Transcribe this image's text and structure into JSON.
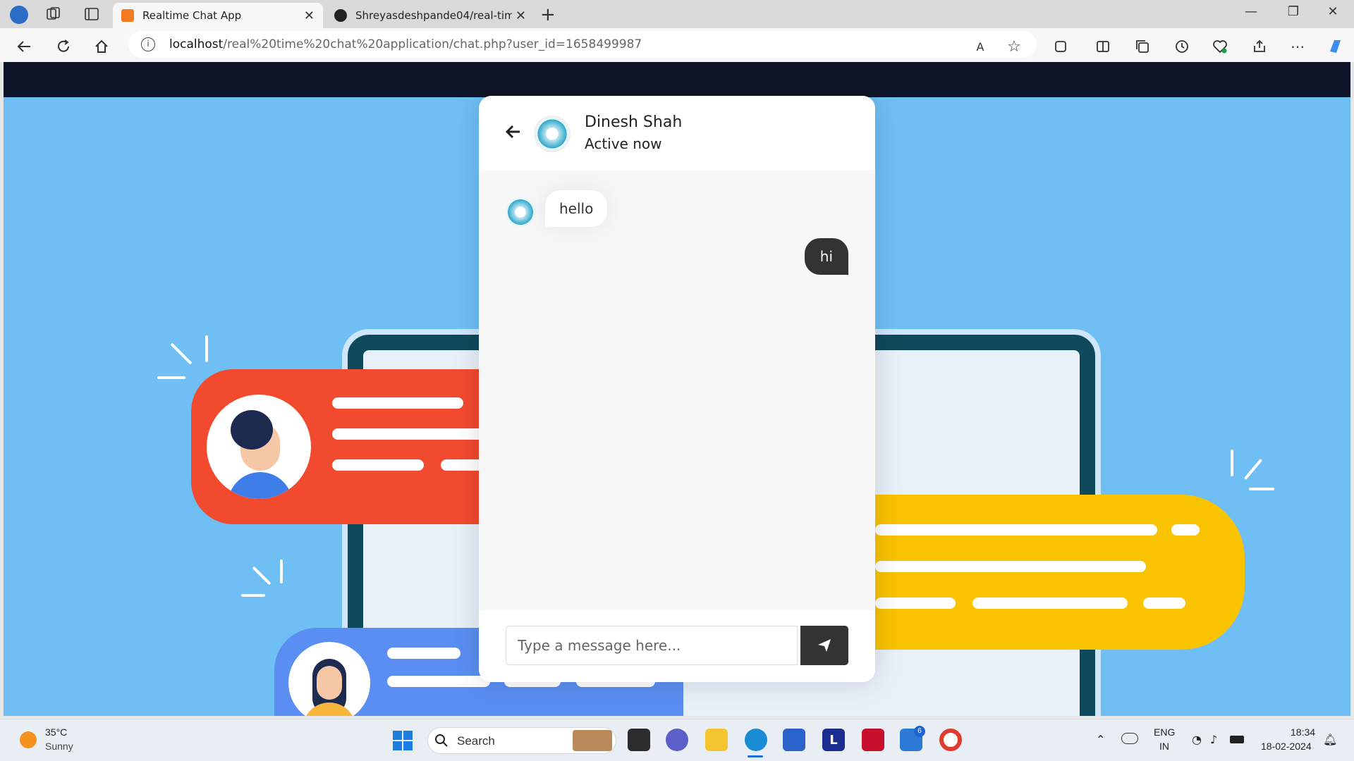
{
  "browser": {
    "tabs": [
      {
        "title": "Realtime Chat App",
        "active": true
      },
      {
        "title": "Shreyasdeshpande04/real-time-c",
        "active": false
      }
    ],
    "url_host": "localhost",
    "url_path": "/real%20time%20chat%20application/chat.php?user_id=1658499987"
  },
  "chat": {
    "user_name": "Dinesh Shah",
    "status": "Active now",
    "messages": [
      {
        "direction": "incoming",
        "text": "hello"
      },
      {
        "direction": "outgoing",
        "text": "hi"
      }
    ],
    "input_placeholder": "Type a message here..."
  },
  "taskbar": {
    "weather_temp": "35°C",
    "weather_desc": "Sunny",
    "search_label": "Search",
    "language": "ENG",
    "region": "IN",
    "time": "18:34",
    "date": "18-02-2024",
    "badge_count": "6"
  },
  "colors": {
    "page_background": "#6fbff5",
    "accent_dark": "#333333",
    "nav_strip": "#101428"
  }
}
